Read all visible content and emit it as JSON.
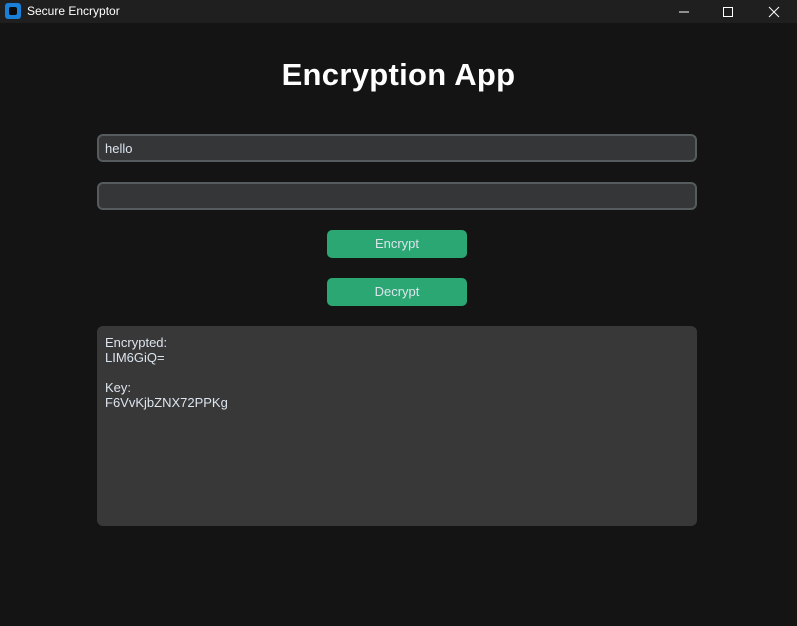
{
  "window": {
    "title": "Secure Encryptor"
  },
  "icons": {
    "app": "app-icon",
    "minimize": "minimize-icon",
    "maximize": "maximize-icon",
    "close": "close-icon"
  },
  "main": {
    "heading": "Encryption App",
    "message_input": {
      "value": "hello",
      "placeholder": ""
    },
    "key_input": {
      "value": "",
      "placeholder": ""
    },
    "encrypt_label": "Encrypt",
    "decrypt_label": "Decrypt",
    "output": {
      "encrypted_label": "Encrypted:",
      "encrypted_value": "LIM6GiQ=",
      "key_label": "Key:",
      "key_value": "F6VvKjbZNX72PPKg"
    }
  },
  "colors": {
    "accent": "#2aa772",
    "background": "#141414",
    "titlebar": "#1f1f1f",
    "field": "#343638",
    "output_bg": "#383838"
  }
}
